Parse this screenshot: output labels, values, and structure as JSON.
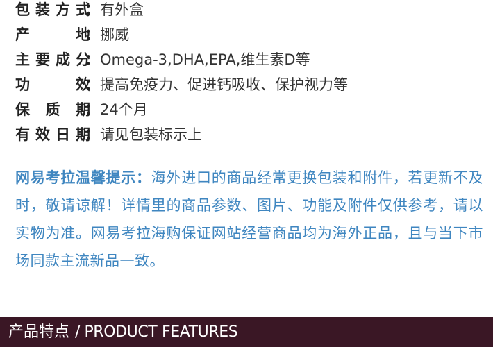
{
  "specs": [
    {
      "label": [
        "包",
        "装",
        "方",
        "式"
      ],
      "value": "有外盒"
    },
    {
      "label": [
        "产",
        "地"
      ],
      "value": "挪威"
    },
    {
      "label": [
        "主",
        "要",
        "成",
        "分"
      ],
      "value": "Omega-3,DHA,EPA,维生素D等"
    },
    {
      "label": [
        "功",
        "效"
      ],
      "value": "提高免疫力、促进钙吸收、保护视力等"
    },
    {
      "label": [
        "保",
        "质",
        "期"
      ],
      "value": "24个月"
    },
    {
      "label": [
        "有",
        "效",
        "日",
        "期"
      ],
      "value": "请见包装标示上"
    }
  ],
  "colon": "：",
  "notice": {
    "title": "网易考拉温馨提示：",
    "body": "海外进口的商品经常更换包装和附件，若更新不及时，敬请谅解！详情里的商品参数、图片、功能及附件仅供参考，请以实物为准。网易考拉海购保证网站经营商品均为海外正品，且与当下市场同款主流新品一致。"
  },
  "banner": {
    "cn": "产品特点",
    "sep": "/",
    "en": "PRODUCT FEATURES"
  },
  "colors": {
    "notice": "#3f86c0",
    "banner_bg": "#3a1725"
  }
}
